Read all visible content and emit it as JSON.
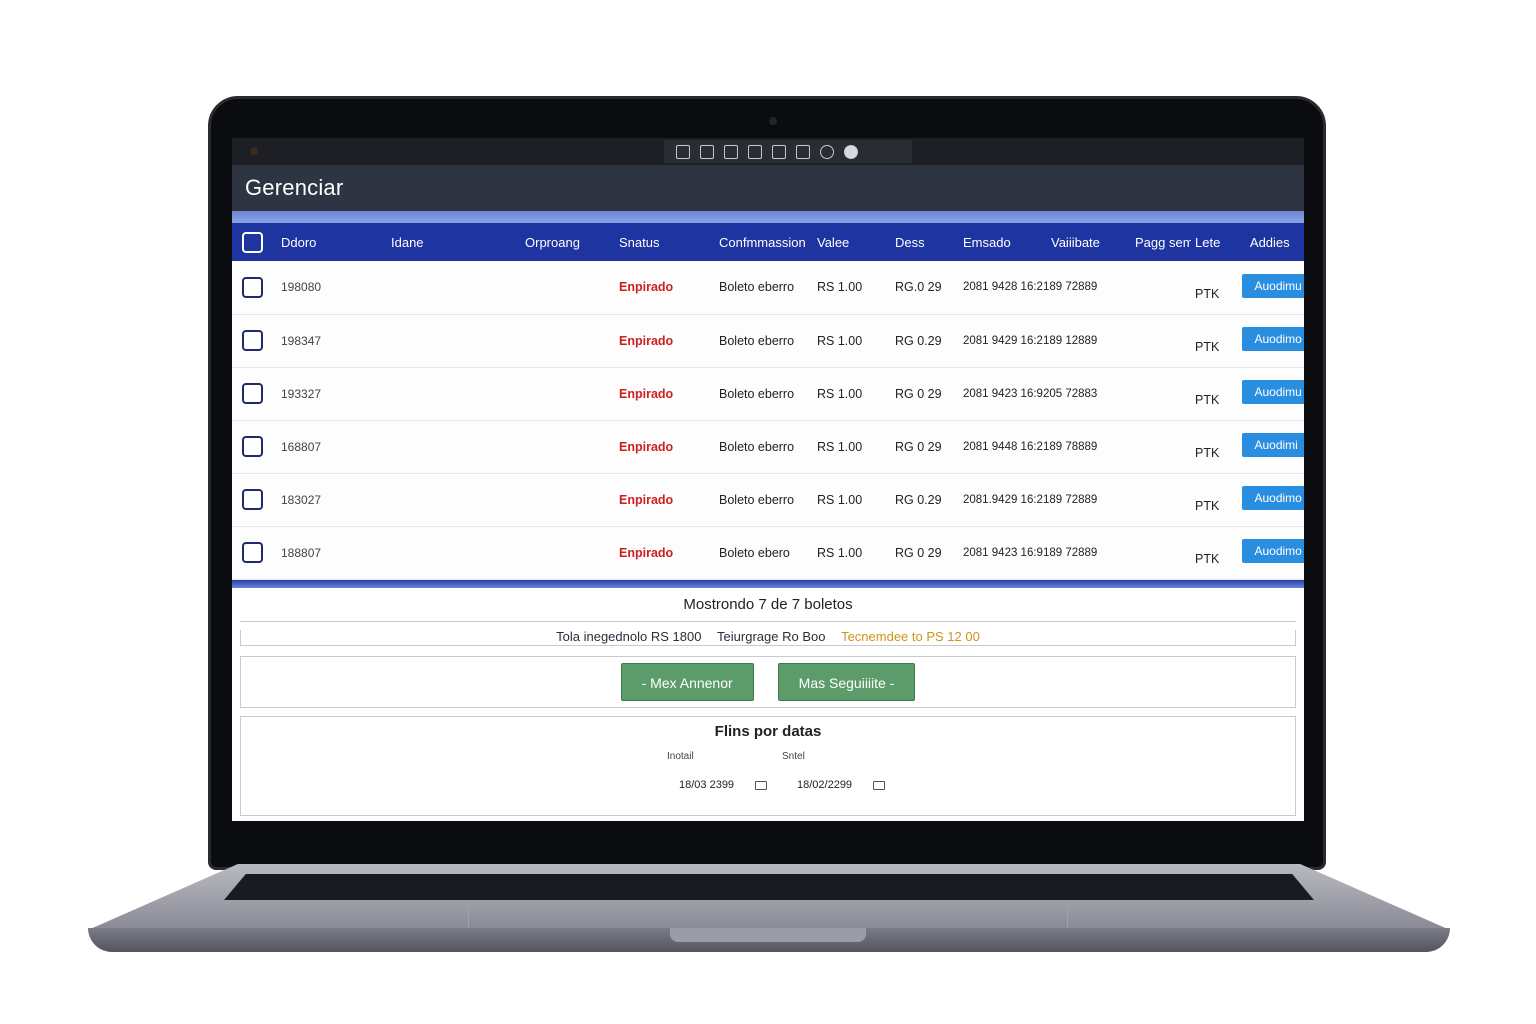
{
  "app": {
    "title": "Gerenciar"
  },
  "toolbar": {
    "icons": [
      "folder-icon",
      "save-icon",
      "cursor-icon",
      "window-icon",
      "document-icon",
      "image-icon",
      "info-icon",
      "globe-icon"
    ]
  },
  "table": {
    "headers": [
      "Ddoro",
      "Idane",
      "Orproang",
      "Snatus",
      "Confmmassion",
      "Valee",
      "Dess",
      "Emsado",
      "Vaiiibate",
      "Pagg sem",
      "Lete",
      "Addies"
    ],
    "rows": [
      {
        "id": "198080",
        "status": "Enpirado",
        "conf": "Boleto eberro",
        "value": "RS 1.00",
        "dess": "RG.0 29",
        "emsado": "2081 9428 16:2189 72889",
        "lete": "PTK",
        "action": "Auodimu"
      },
      {
        "id": "198347",
        "status": "Enpirado",
        "conf": "Boleto eberro",
        "value": "RS 1.00",
        "dess": "RG 0.29",
        "emsado": "2081 9429 16:2189 12889",
        "lete": "PTK",
        "action": "Auodimo"
      },
      {
        "id": "193327",
        "status": "Enpirado",
        "conf": "Boleto eberro",
        "value": "RS 1.00",
        "dess": "RG 0 29",
        "emsado": "2081 9423 16:9205 72883",
        "lete": "PTK",
        "action": "Auodimu"
      },
      {
        "id": "168807",
        "status": "Enpirado",
        "conf": "Boleto eberro",
        "value": "RS 1.00",
        "dess": "RG 0 29",
        "emsado": "2081 9448 16:2189 78889",
        "lete": "PTK",
        "action": "Auodimi"
      },
      {
        "id": "183027",
        "status": "Enpirado",
        "conf": "Boleto eberro",
        "value": "RS 1.00",
        "dess": "RG 0.29",
        "emsado": "2081.9429 16:2189 72889",
        "lete": "PTK",
        "action": "Auodimo"
      },
      {
        "id": "188807",
        "status": "Enpirado",
        "conf": "Boleto ebero",
        "value": "RS 1.00",
        "dess": "RG 0 29",
        "emsado": "2081 9423 16:9189 72889",
        "lete": "PTK",
        "action": "Auodimo"
      }
    ]
  },
  "summary": {
    "showing": "Mostrondo 7 de 7 boletos",
    "total1": "Tola inegednolo RS 1800",
    "total2": "Teiurgrage Ro Boo",
    "total3": "Tecnemdee to PS 12 00"
  },
  "pager": {
    "prev": "- Mex Annenor",
    "next": "Mas Seguiiiite -"
  },
  "filter": {
    "title": "Flins por datas",
    "start_label": "Inotail",
    "end_label": "Sntel",
    "start_date": "18/03 2399",
    "end_date": "18/02/2299"
  },
  "colors": {
    "header_bg": "#1e34a0",
    "status_red": "#cc1f1f",
    "action_blue": "#2a8ee0",
    "pager_green": "#5c9c6a"
  }
}
